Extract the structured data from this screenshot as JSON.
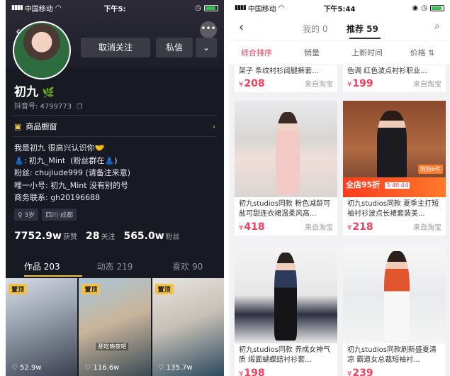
{
  "left": {
    "status": {
      "carrier": "中国移动",
      "time": "下午5:"
    },
    "buttons": {
      "unfollow": "取消关注",
      "message": "私信",
      "dropdown": "⌄",
      "more": "•••"
    },
    "profile": {
      "name": "初九",
      "douyin_id": "抖音号: 4799773",
      "shop_label": "商品橱窗",
      "bio": "我是初九 很高兴认识你🤝\n👗: 初九_Mint  (粉丝群在👗)\n粉丝: chujiude999 (请备注来意)\n唯一小号: 初九_Mint 没有别的号\n商务联系: gh20196688",
      "tags": [
        "♀ 3岁",
        "四川·成都"
      ],
      "stats": [
        {
          "num": "7752.9w",
          "label": "获赞"
        },
        {
          "num": "28",
          "label": "关注"
        },
        {
          "num": "565.0w",
          "label": "粉丝"
        }
      ]
    },
    "tabs": [
      "作品 203",
      "动态 219",
      "喜欢 90"
    ],
    "videos": [
      {
        "pin": "置顶",
        "likes": "♡ 52.9w",
        "caption": ""
      },
      {
        "pin": "置顶",
        "likes": "♡ 116.6w",
        "caption": "那吃晚夜吧"
      },
      {
        "pin": "置顶",
        "likes": "♡ 135.7w",
        "caption": ""
      }
    ]
  },
  "right": {
    "status": {
      "carrier": "中国移动",
      "time": "下午5:44"
    },
    "nav": {
      "tab_mine": "我的 0",
      "tab_recommend": "推荐 59"
    },
    "sort": [
      "综合排序",
      "销量",
      "上新时间",
      "价格 ⇅"
    ],
    "products": [
      {
        "title": "架子 条纹衬衫阔腿裤套...",
        "price": "208",
        "source": "来自淘宝"
      },
      {
        "title": "色调 红色波点衬衫职业...",
        "price": "199",
        "source": "来自淘宝"
      },
      {
        "title": "初九studios同款 粉色减龄可盐可甜连衣裙温柔风高...",
        "price": "418",
        "source": "来自淘宝"
      },
      {
        "title": "初九studios同款 夏季主打短袖衬衫波点长裙套装美...",
        "price": "218",
        "source": "来自淘宝"
      },
      {
        "title": "初九studios同款 养成女神气质 缎面蝴蝶结衬衫套...",
        "price": "198",
        "source": ""
      },
      {
        "title": "初九studios同款刷新盛夏清凉 霸道女总裁短袖衬...",
        "price": "239",
        "source": ""
      }
    ],
    "promo": {
      "sale": "全店95折",
      "timer": "3:48:44",
      "badge": "限购6件"
    },
    "currency": "¥"
  },
  "colors": {
    "accent": "#f33e5e",
    "gold": "#f2c146",
    "dark_bg": "#171923"
  }
}
